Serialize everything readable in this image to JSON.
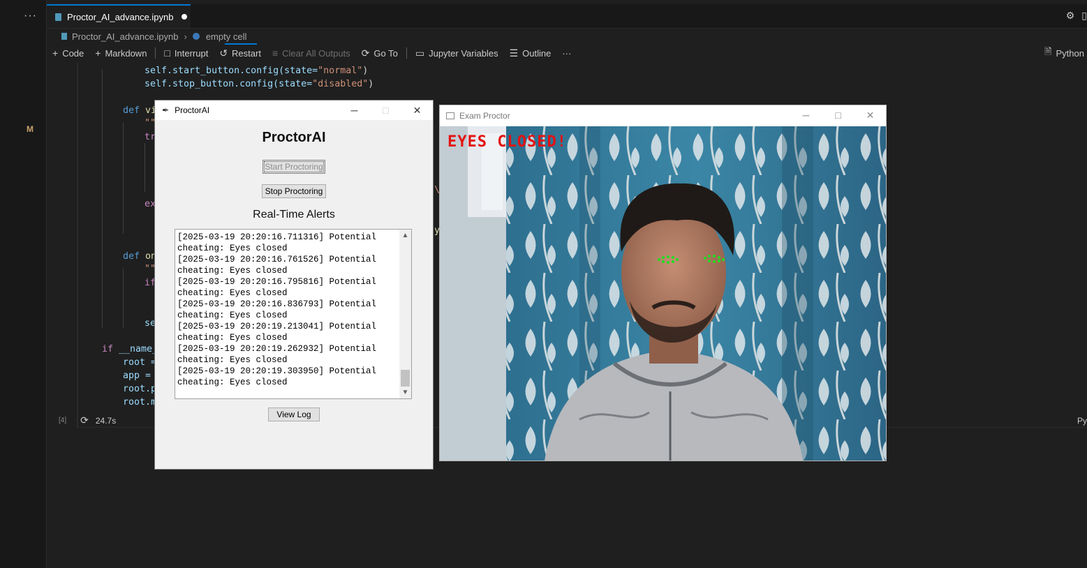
{
  "editor": {
    "more_label": "···",
    "modified_marker": "M",
    "tab": {
      "filename": "Proctor_AI_advance.ipynb"
    },
    "breadcrumb": {
      "file": "Proctor_AI_advance.ipynb",
      "cell": "empty cell"
    },
    "toolbar": {
      "code": "Code",
      "markdown": "Markdown",
      "interrupt": "Interrupt",
      "restart": "Restart",
      "clear_all_outputs": "Clear All Outputs",
      "go_to": "Go To",
      "jupyter_variables": "Jupyter Variables",
      "outline": "Outline",
      "more": "···",
      "kernel": "Python"
    },
    "code": {
      "l1_obj": "self.start_button.config(state=",
      "l1_str": "\"normal\"",
      "l2_obj": "self.stop_button.config(state=",
      "l2_str": "\"disabled\"",
      "def1": "def",
      "def1_name": "vi",
      "quote1": "\"\"",
      "try_kw": "tr",
      "ex_kw": "ex",
      "backslash": "\\",
      "y_frag": "y",
      "def2": "def",
      "def2_name": "on",
      "quote2": "\"\"",
      "if_kw": "if",
      "se_frag": "se",
      "main_if": "if",
      "main_name": " __name_",
      "root_eq": "root =",
      "app_eq": "app =",
      "root_p": "root.p",
      "root_m": "root.m"
    },
    "cell_status": {
      "exec_count": "[4]",
      "duration": "24.7s",
      "lang_right": "Py"
    }
  },
  "proctor_window": {
    "title": "ProctorAI",
    "heading": "ProctorAI",
    "start_button": "Start Proctoring",
    "stop_button": "Stop Proctoring",
    "alerts_heading": "Real-Time Alerts",
    "alerts": [
      "[2025-03-19 20:20:16.711316] Potential",
      "cheating: Eyes closed",
      "[2025-03-19 20:20:16.761526] Potential",
      "cheating: Eyes closed",
      "[2025-03-19 20:20:16.795816] Potential",
      "cheating: Eyes closed",
      "[2025-03-19 20:20:16.836793] Potential",
      "cheating: Eyes closed",
      "[2025-03-19 20:20:19.213041] Potential",
      "cheating: Eyes closed",
      "[2025-03-19 20:20:19.262932] Potential",
      "cheating: Eyes closed",
      "[2025-03-19 20:20:19.303950] Potential",
      "cheating: Eyes closed"
    ],
    "view_log_button": "View Log"
  },
  "camera_window": {
    "title": "Exam Proctor",
    "overlay_text": "EYES CLOSED!"
  },
  "icons": {
    "file": "file-icon",
    "python": "python-icon",
    "settings": "gear-icon",
    "feather": "feather-icon"
  },
  "colors": {
    "accent": "#0078d4",
    "alert_overlay": "#e31212",
    "landmarks": "#22dd22"
  }
}
